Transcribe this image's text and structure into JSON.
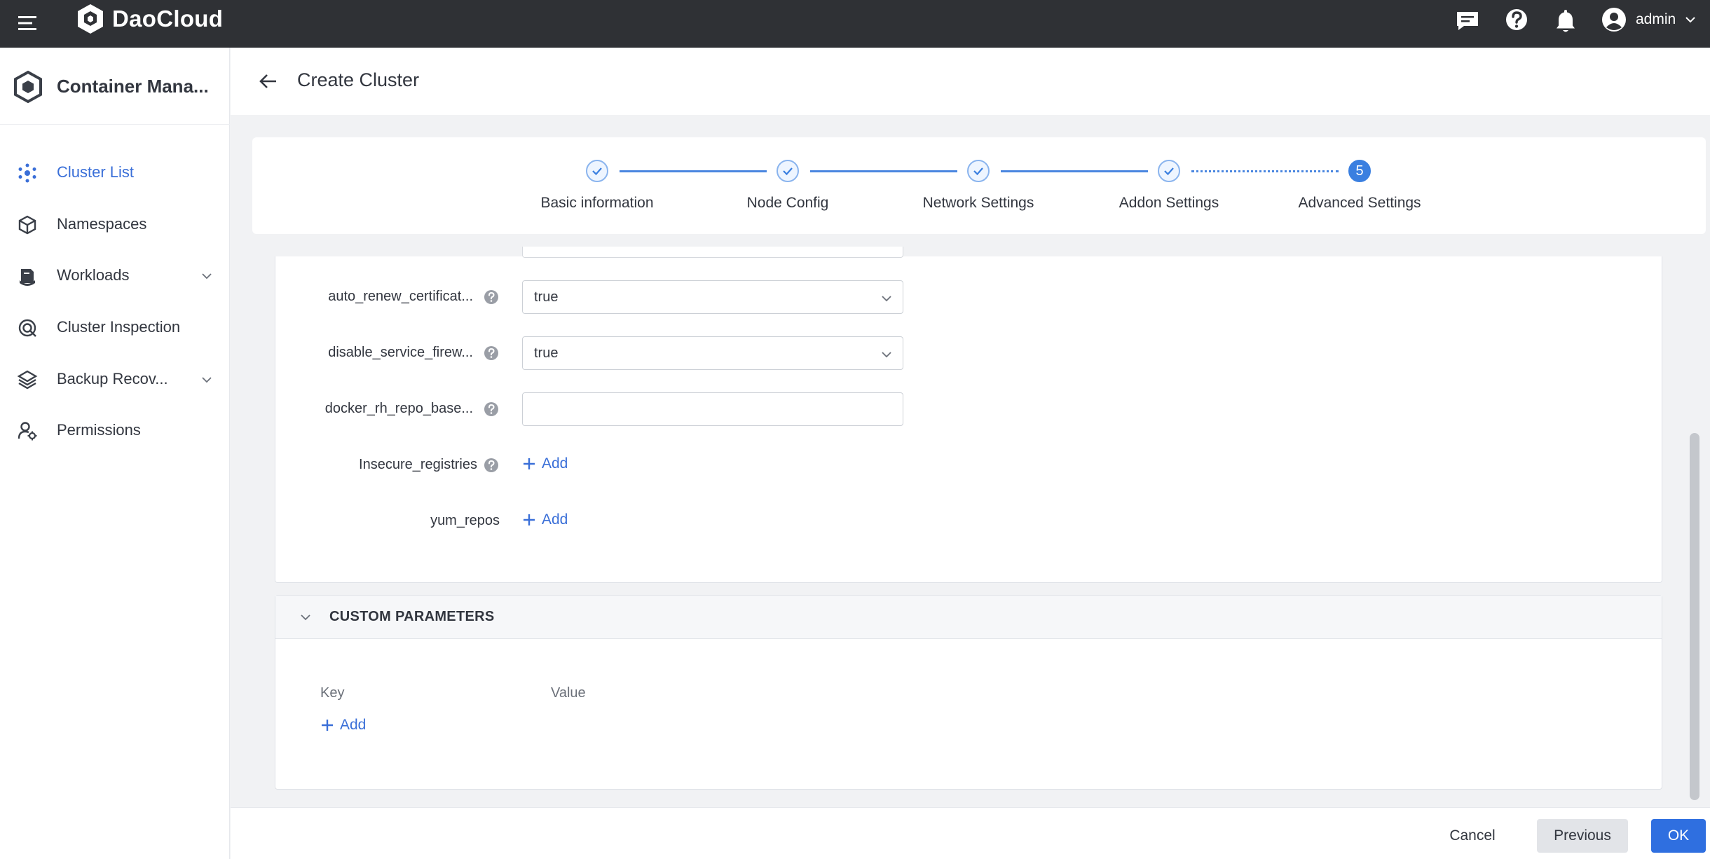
{
  "topbar": {
    "logo_text": "DaoCloud",
    "user_name": "admin",
    "icons": [
      "menu-icon",
      "message-icon",
      "help-icon",
      "bell-icon",
      "user-avatar-icon",
      "chevron-down-icon"
    ]
  },
  "sidebar": {
    "title": "Container Mana...",
    "items": [
      {
        "label": "Cluster List",
        "icon": "cluster-icon",
        "active": true
      },
      {
        "label": "Namespaces",
        "icon": "cube-icon"
      },
      {
        "label": "Workloads",
        "icon": "workload-icon",
        "expandable": true
      },
      {
        "label": "Cluster Inspection",
        "icon": "inspection-icon"
      },
      {
        "label": "Backup Recov...",
        "icon": "backup-icon",
        "expandable": true
      },
      {
        "label": "Permissions",
        "icon": "permissions-icon"
      }
    ]
  },
  "header": {
    "title": "Create Cluster"
  },
  "stepper": {
    "steps": [
      {
        "label": "Basic information",
        "status": "done"
      },
      {
        "label": "Node Config",
        "status": "done"
      },
      {
        "label": "Network Settings",
        "status": "done"
      },
      {
        "label": "Addon Settings",
        "status": "done"
      },
      {
        "label": "Advanced Settings",
        "status": "current",
        "number": "5"
      }
    ]
  },
  "form": {
    "fields": [
      {
        "label": "auto_renew_certificat...",
        "type": "select",
        "value": "true"
      },
      {
        "label": "disable_service_firew...",
        "type": "select",
        "value": "true"
      },
      {
        "label": "docker_rh_repo_base...",
        "type": "input",
        "value": ""
      },
      {
        "label": "Insecure_registries",
        "type": "add",
        "add_label": "Add"
      },
      {
        "label": "yum_repos",
        "type": "add",
        "add_label": "Add"
      }
    ]
  },
  "custom_parameters": {
    "title": "CUSTOM PARAMETERS",
    "key_header": "Key",
    "value_header": "Value",
    "add_label": "Add"
  },
  "footer": {
    "cancel_label": "Cancel",
    "previous_label": "Previous",
    "ok_label": "OK"
  },
  "colors": {
    "accent": "#3a6fd8",
    "topbar": "#2f3135",
    "primary_button": "#2f6fe0"
  }
}
